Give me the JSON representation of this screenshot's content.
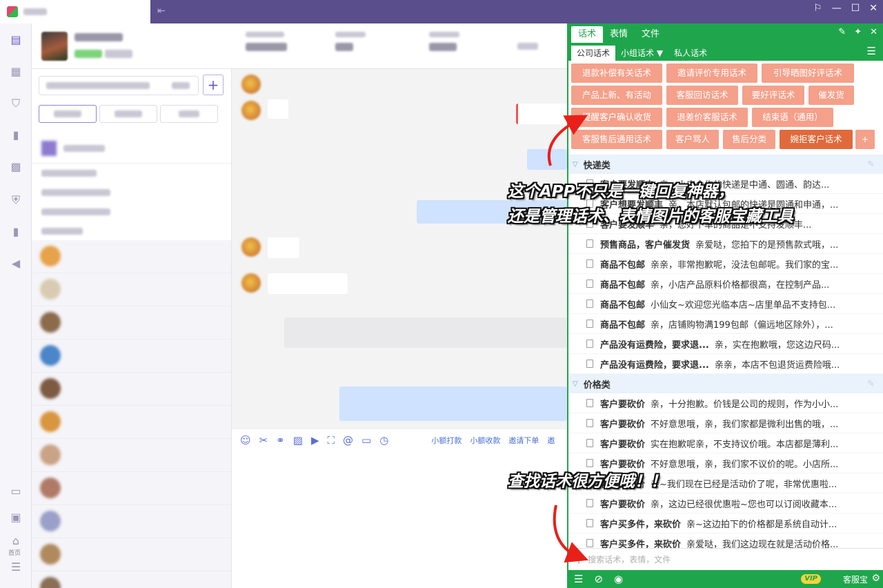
{
  "panel": {
    "tabs": [
      "话术",
      "表情",
      "文件"
    ],
    "subtabs": [
      "公司话术",
      "小组话术",
      "私人话术"
    ],
    "tags": [
      [
        "退款补偿有关话术",
        "邀请评价专用话术",
        "引导晒图好评话术"
      ],
      [
        "产品上新、有活动",
        "客服回访话术",
        "要好评话术",
        "催发货"
      ],
      [
        "提醒客户确认收货",
        "退差价客服话术",
        "结束语（通用）"
      ],
      [
        "客服售后通用话术",
        "客户骂人",
        "售后分类",
        "婉拒客户话术",
        "+"
      ]
    ],
    "categories": [
      {
        "name": "快递类",
        "items": [
          {
            "k": "客户要发顺丰",
            "v": "亲，小店合作的快递是中通、圆通、韵达..."
          },
          {
            "k": "客户想要发顺丰",
            "v": "亲，本店默认包邮的快递是圆通和申通，..."
          },
          {
            "k": "客户要发顺丰",
            "v": "亲，您好下单的商品是不支持发顺丰..."
          },
          {
            "k": "预售商品，客户催发货",
            "v": "亲爱哒，您拍下的是预售款式哦，..."
          },
          {
            "k": "商品不包邮",
            "v": "亲亲，非常抱歉呢，没法包邮呢。我们家的宝..."
          },
          {
            "k": "商品不包邮",
            "v": "亲，小店产品原料价格都很高，在控制产品..."
          },
          {
            "k": "商品不包邮",
            "v": "小仙女~欢迎您光临本店~店里单品不支持包..."
          },
          {
            "k": "商品不包邮",
            "v": "亲，店铺购物满199包邮（偏远地区除外），..."
          },
          {
            "k": "产品没有运费险，要求退...",
            "v": "亲，实在抱歉哦，您这边尺码..."
          },
          {
            "k": "产品没有运费险，要求退...",
            "v": "亲亲，本店不包退货运费险哦..."
          }
        ]
      },
      {
        "name": "价格类",
        "items": [
          {
            "k": "客户要砍价",
            "v": "亲，十分抱歉。价钱是公司的规则，作为小小..."
          },
          {
            "k": "客户要砍价",
            "v": "不好意思哦，亲，我们家都是微利出售的哦，..."
          },
          {
            "k": "客户要砍价",
            "v": "实在抱歉呢亲，不支持议价哦。本店都是薄利..."
          },
          {
            "k": "客户要砍价",
            "v": "不好意思哦，亲，我们家不议价的呢。小店所..."
          },
          {
            "k": "客户要砍价",
            "v": "亲~我们现在已经是活动价了呢，非常优惠啦..."
          },
          {
            "k": "客户要砍价",
            "v": "亲，这边已经很优惠啦~您也可以订阅收藏本..."
          },
          {
            "k": "客户买多件，来砍价",
            "v": "亲~这边拍下的价格都是系统自动计..."
          },
          {
            "k": "客户买多件，来砍价",
            "v": "亲爱哒，我们这边现在就是活动价格..."
          }
        ]
      }
    ],
    "search_placeholder": "搜索话术，表情，文件",
    "footer": {
      "vip": "VIP",
      "name": "客服宝"
    }
  },
  "chat_toolbar": {
    "links": [
      "小额打款",
      "小额收款",
      "邀请下单",
      "邀"
    ]
  },
  "annotations": {
    "top_line1": "这个APP不只是一键回复神器，",
    "top_line2": "还是管理话术、表情图片的客服宝藏工具",
    "bottom": "查找话术很方便哦！！"
  },
  "rail": {
    "home_label": "首页"
  },
  "colors": {
    "green": "#1fa64c",
    "tag": "#f4a08a",
    "tag_active": "#e06a3c",
    "purple": "#5a4e8c"
  }
}
